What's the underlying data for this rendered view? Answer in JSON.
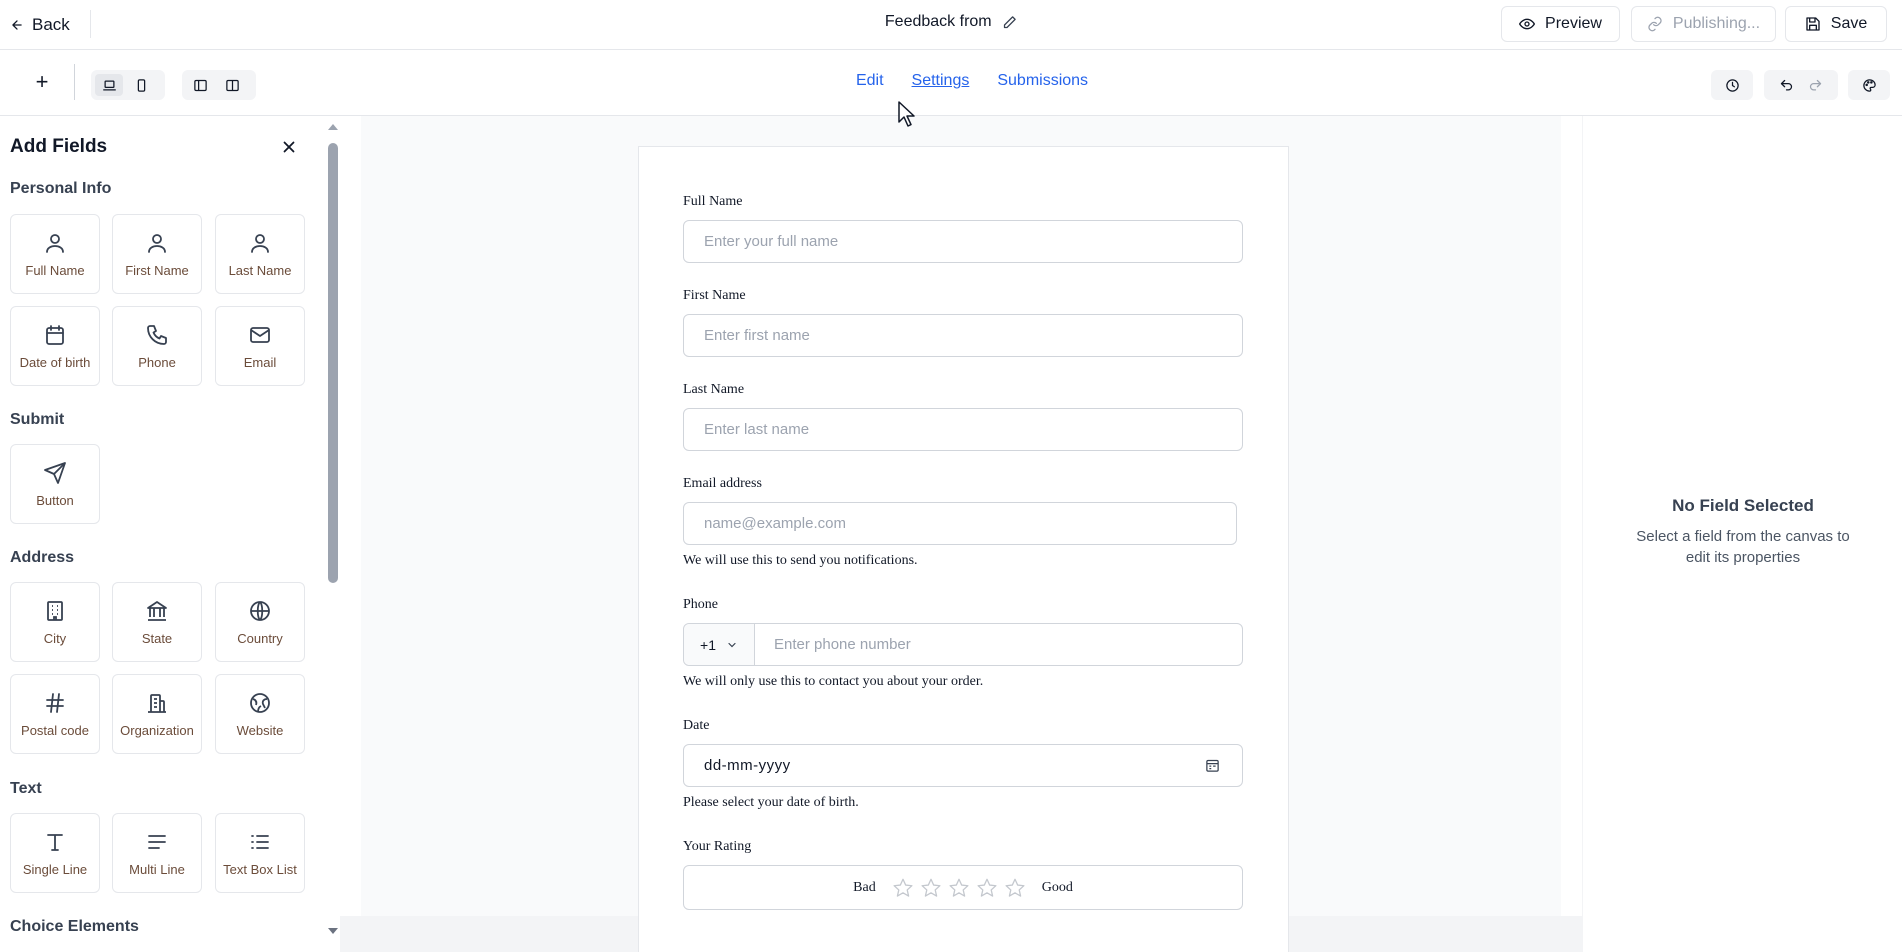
{
  "header": {
    "back_label": "Back",
    "title": "Feedback from",
    "preview_label": "Preview",
    "publishing_label": "Publishing...",
    "save_label": "Save"
  },
  "toolbar": {
    "add_label": "+",
    "tabs": [
      {
        "label": "Edit"
      },
      {
        "label": "Settings"
      },
      {
        "label": "Submissions"
      }
    ]
  },
  "left_panel": {
    "title": "Add Fields",
    "sections": [
      {
        "title": "Personal Info",
        "items": [
          {
            "label": "Full Name",
            "icon": "user-icon"
          },
          {
            "label": "First Name",
            "icon": "user-icon"
          },
          {
            "label": "Last Name",
            "icon": "user-icon"
          },
          {
            "label": "Date of birth",
            "icon": "calendar-icon"
          },
          {
            "label": "Phone",
            "icon": "phone-icon"
          },
          {
            "label": "Email",
            "icon": "mail-icon"
          }
        ]
      },
      {
        "title": "Submit",
        "items": [
          {
            "label": "Button",
            "icon": "send-icon"
          }
        ]
      },
      {
        "title": "Address",
        "items": [
          {
            "label": "City",
            "icon": "building-icon"
          },
          {
            "label": "State",
            "icon": "landmark-icon"
          },
          {
            "label": "Country",
            "icon": "globe-icon"
          },
          {
            "label": "Postal code",
            "icon": "hash-icon"
          },
          {
            "label": "Organization",
            "icon": "office-icon"
          },
          {
            "label": "Website",
            "icon": "web-icon"
          }
        ]
      },
      {
        "title": "Text",
        "items": [
          {
            "label": "Single Line",
            "icon": "type-icon"
          },
          {
            "label": "Multi Line",
            "icon": "align-icon"
          },
          {
            "label": "Text Box List",
            "icon": "list-icon"
          }
        ]
      },
      {
        "title": "Choice Elements",
        "items": []
      }
    ]
  },
  "form": {
    "full_name": {
      "label": "Full Name",
      "placeholder": "Enter your full name"
    },
    "first_name": {
      "label": "First Name",
      "placeholder": "Enter first name"
    },
    "last_name": {
      "label": "Last Name",
      "placeholder": "Enter last name"
    },
    "email": {
      "label": "Email address",
      "placeholder": "name@example.com",
      "help": "We will use this to send you notifications."
    },
    "phone": {
      "label": "Phone",
      "prefix": "+1",
      "placeholder": "Enter phone number",
      "help": "We will only use this to contact you about your order."
    },
    "date": {
      "label": "Date",
      "value": "dd-mm-yyyy",
      "help": "Please select your date of birth."
    },
    "rating": {
      "label": "Your Rating",
      "low": "Bad",
      "high": "Good",
      "stars": 5
    }
  },
  "right_panel": {
    "title": "No Field Selected",
    "subtitle": "Select a field from the canvas to edit its properties"
  },
  "colors": {
    "accent": "#2563eb",
    "border": "#e5e7eb"
  }
}
